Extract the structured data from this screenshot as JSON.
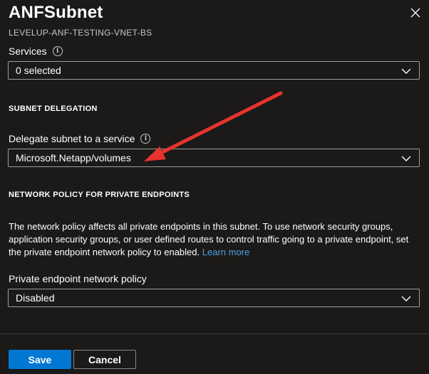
{
  "header": {
    "title": "ANFSubnet",
    "subtitle": "LEVELUP-ANF-TESTING-VNET-BS"
  },
  "services": {
    "label": "Services",
    "value": "0 selected"
  },
  "delegation": {
    "section_title": "SUBNET DELEGATION",
    "label": "Delegate subnet to a service",
    "value": "Microsoft.Netapp/volumes"
  },
  "network_policy": {
    "section_title": "NETWORK POLICY FOR PRIVATE ENDPOINTS",
    "description": "The network policy affects all private endpoints in this subnet. To use network security groups, application security groups, or user defined routes to control traffic going to a private endpoint, set the private endpoint network policy to enabled.",
    "learn_more": "Learn more",
    "label": "Private endpoint network policy",
    "value": "Disabled"
  },
  "footer": {
    "save_label": "Save",
    "cancel_label": "Cancel"
  },
  "icons": {
    "close": "close-icon",
    "info": "info-icon",
    "chevron": "chevron-down-icon",
    "annotation": "red-arrow"
  },
  "colors": {
    "background": "#1b1a19",
    "accent": "#0078d4",
    "link": "#4aa0e6",
    "annotation": "#e8322f"
  }
}
